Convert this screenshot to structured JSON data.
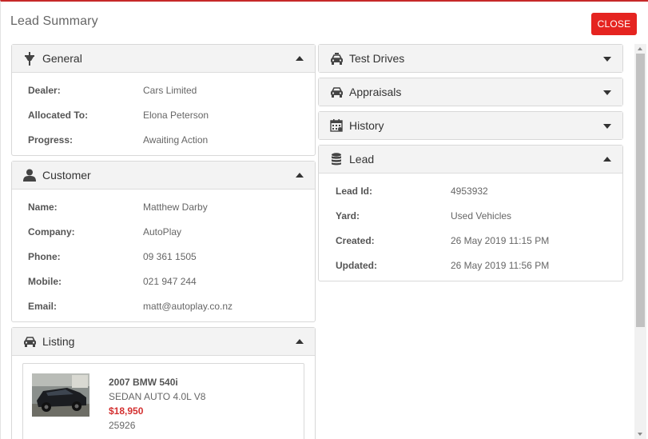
{
  "modal": {
    "title": "Lead Summary",
    "close_label": "CLOSE"
  },
  "general": {
    "title": "General",
    "rows": [
      {
        "label": "Dealer:",
        "value": "Cars Limited"
      },
      {
        "label": "Allocated To:",
        "value": "Elona Peterson"
      },
      {
        "label": "Progress:",
        "value": "Awaiting Action"
      }
    ]
  },
  "customer": {
    "title": "Customer",
    "rows": [
      {
        "label": "Name:",
        "value": "Matthew Darby"
      },
      {
        "label": "Company:",
        "value": "AutoPlay"
      },
      {
        "label": "Phone:",
        "value": "09 361 1505"
      },
      {
        "label": "Mobile:",
        "value": "021 947 244"
      },
      {
        "label": "Email:",
        "value": "matt@autoplay.co.nz"
      }
    ]
  },
  "listing": {
    "title": "Listing",
    "car_title": "2007 BMW 540i",
    "car_sub": "SEDAN AUTO 4.0L V8",
    "price": "$18,950",
    "odometer": "25926"
  },
  "test_drives": {
    "title": "Test Drives"
  },
  "appraisals": {
    "title": "Appraisals"
  },
  "history": {
    "title": "History"
  },
  "lead": {
    "title": "Lead",
    "rows": [
      {
        "label": "Lead Id:",
        "value": "4953932"
      },
      {
        "label": "Yard:",
        "value": "Used Vehicles"
      },
      {
        "label": "Created:",
        "value": "26 May 2019 11:15 PM"
      },
      {
        "label": "Updated:",
        "value": "26 May 2019 11:56 PM"
      }
    ]
  },
  "colors": {
    "accent": "#e52420",
    "price": "#d32f2f",
    "header_bg": "#f3f3f3"
  },
  "icons": {
    "general": "plug-icon",
    "customer": "user-icon",
    "listing": "car-icon",
    "test_drives": "taxi-icon",
    "appraisals": "car-icon",
    "history": "calendar-icon",
    "lead": "database-icon"
  }
}
